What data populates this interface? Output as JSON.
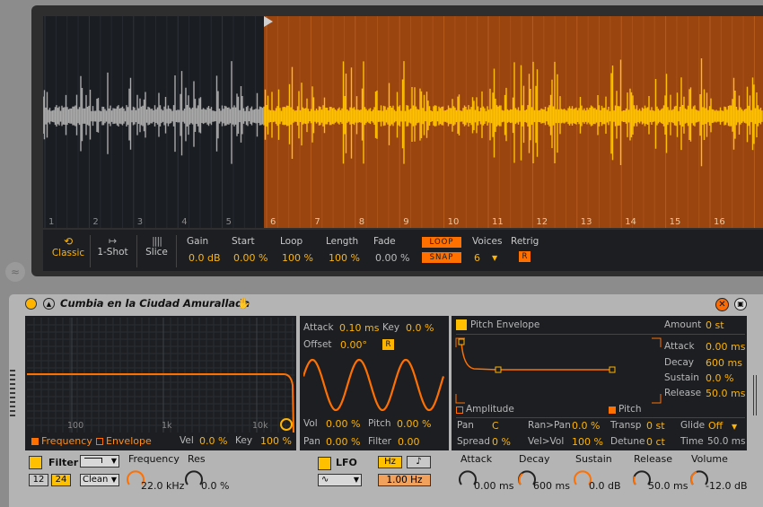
{
  "sample": {
    "markers": [
      "1",
      "2",
      "3",
      "4",
      "5",
      "6",
      "7",
      "8",
      "9",
      "10",
      "11",
      "12",
      "13",
      "14",
      "15",
      "16"
    ],
    "modes": {
      "classic": "Classic",
      "oneshot": "1-Shot",
      "slice": "Slice"
    },
    "gain_label": "Gain",
    "gain_value": "0.0 dB",
    "start_label": "Start",
    "start_value": "0.00 %",
    "loop_label": "Loop",
    "loop_value": "100 %",
    "length_label": "Length",
    "length_value": "100 %",
    "fade_label": "Fade",
    "fade_value": "0.00 %",
    "loop_btn": "LOOP",
    "snap_btn": "SNAP",
    "voices_label": "Voices",
    "voices_value": "6",
    "retrig_label": "Retrig",
    "retrig_btn": "R"
  },
  "device": {
    "title": "Cumbia en la Ciudad Amurallada"
  },
  "filter": {
    "freq_marks": [
      "100",
      "1k",
      "10k"
    ],
    "frequency_tab": "Frequency",
    "envelope_tab": "Envelope",
    "vel_label": "Vel",
    "vel_value": "0.0 %",
    "key_label": "Key",
    "key_value": "100 %",
    "name": "Filter",
    "slope_12": "12",
    "slope_24": "24",
    "circuit": "Clean",
    "frequency_label": "Frequency",
    "frequency_value": "22.0 kHz",
    "res_label": "Res",
    "res_value": "0.0 %"
  },
  "lfo": {
    "attack_label": "Attack",
    "attack_value": "0.10 ms",
    "key_label": "Key",
    "key_value": "0.0 %",
    "offset_label": "Offset",
    "offset_value": "0.00°",
    "retrig_btn": "R",
    "vol_label": "Vol",
    "vol_value": "0.00 %",
    "pitch_label": "Pitch",
    "pitch_value": "0.00 %",
    "pan_label": "Pan",
    "pan_value": "0.00 %",
    "filter_label": "Filter",
    "filter_value": "0.00",
    "name": "LFO",
    "hz_btn": "Hz",
    "note_btn": "♪",
    "rate_value": "1.00 Hz"
  },
  "pitch_env": {
    "title": "Pitch Envelope",
    "amount_label": "Amount",
    "amount_value": "0 st",
    "attack_label": "Attack",
    "attack_value": "0.00 ms",
    "decay_label": "Decay",
    "decay_value": "600 ms",
    "sustain_label": "Sustain",
    "sustain_value": "0.0 %",
    "release_label": "Release",
    "release_value": "50.0 ms",
    "amplitude_tab": "Amplitude",
    "pitch_tab": "Pitch",
    "pan_label": "Pan",
    "pan_value": "C",
    "ranpan_label": "Ran>Pan",
    "ranpan_value": "0.0 %",
    "transp_label": "Transp",
    "transp_value": "0 st",
    "glide_label": "Glide",
    "glide_value": "Off",
    "spread_label": "Spread",
    "spread_value": "0 %",
    "velvol_label": "Vel>Vol",
    "velvol_value": "100 %",
    "detune_label": "Detune",
    "detune_value": "0 ct",
    "time_label": "Time",
    "time_value": "50.0 ms"
  },
  "amp_env": {
    "attack_label": "Attack",
    "attack_value": "0.00 ms",
    "decay_label": "Decay",
    "decay_value": "600 ms",
    "sustain_label": "Sustain",
    "sustain_value": "0.0 dB",
    "release_label": "Release",
    "release_value": "50.0 ms",
    "volume_label": "Volume",
    "volume_value": "-12.0 dB"
  },
  "colors": {
    "accent": "#ff7000",
    "value": "#ffb400",
    "waveform": "#ffc000",
    "region": "#9a4410"
  }
}
